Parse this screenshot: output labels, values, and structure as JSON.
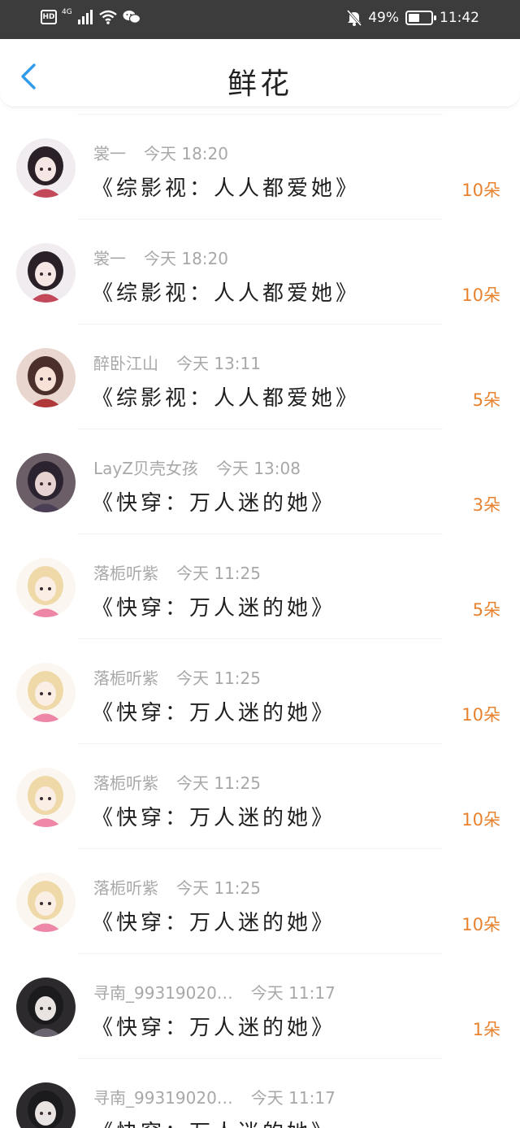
{
  "status_bar": {
    "hd": "HD",
    "network": "4G",
    "battery_text": "49%",
    "battery_level": 0.49,
    "time": "11:42",
    "icons": [
      "signal-icon",
      "wifi-icon",
      "wechat-icon",
      "mute-bell-icon",
      "battery-icon"
    ]
  },
  "nav": {
    "title": "鲜花",
    "back_icon": "chevron-left-icon",
    "accent_color": "#2f9bea"
  },
  "colors": {
    "amount": "#e8822e",
    "meta": "#a8a8a8",
    "status_bg": "#3c3c3c"
  },
  "items": [
    {
      "user": "裳一",
      "time": "今天 18:20",
      "book": "《综影视：人人都爱她》",
      "amount": "10朵"
    },
    {
      "user": "裳一",
      "time": "今天 18:20",
      "book": "《综影视：人人都爱她》",
      "amount": "10朵"
    },
    {
      "user": "醉卧江山",
      "time": "今天 13:11",
      "book": "《综影视：人人都爱她》",
      "amount": "5朵"
    },
    {
      "user": "LayZ贝壳女孩",
      "time": "今天 13:08",
      "book": "《快穿：万人迷的她》",
      "amount": "3朵"
    },
    {
      "user": "落栀听紫",
      "time": "今天 11:25",
      "book": "《快穿：万人迷的她》",
      "amount": "5朵"
    },
    {
      "user": "落栀听紫",
      "time": "今天 11:25",
      "book": "《快穿：万人迷的她》",
      "amount": "10朵"
    },
    {
      "user": "落栀听紫",
      "time": "今天 11:25",
      "book": "《快穿：万人迷的她》",
      "amount": "10朵"
    },
    {
      "user": "落栀听紫",
      "time": "今天 11:25",
      "book": "《快穿：万人迷的她》",
      "amount": "10朵"
    },
    {
      "user": "寻南_99319020…",
      "time": "今天 11:17",
      "book": "《快穿：万人迷的她》",
      "amount": "1朵"
    },
    {
      "user": "寻南_99319020…",
      "time": "今天 11:17",
      "book": "《快穿：万人迷的她》",
      "amount": ""
    }
  ]
}
